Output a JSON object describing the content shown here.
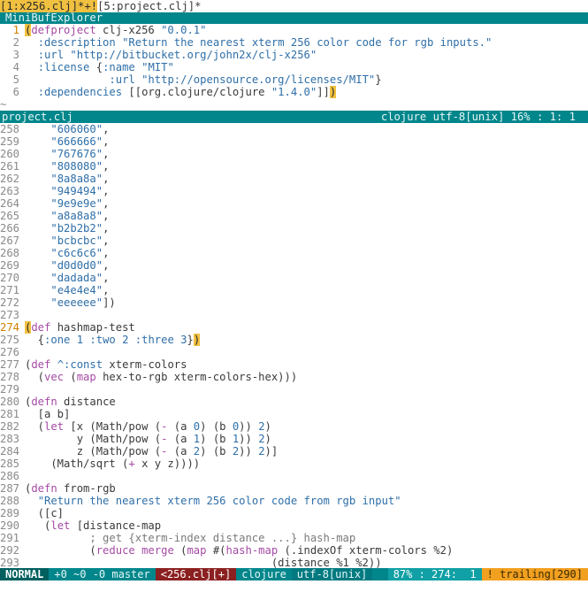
{
  "buffer_tabs": {
    "active": "[1:x256.clj]*+!",
    "other": "[5:project.clj]*"
  },
  "minibuf_title": "MiniBufExplorer",
  "top_window": {
    "lines": [
      {
        "n": "1",
        "cur": true,
        "tokens": [
          [
            "hl",
            "("
          ],
          [
            "fn",
            "defproject"
          ],
          [
            "p",
            " clj-x256 "
          ],
          [
            "str",
            "\"0.0.1\""
          ]
        ]
      },
      {
        "n": "2",
        "tokens": [
          [
            "p",
            "  "
          ],
          [
            "kwd",
            ":description"
          ],
          [
            "p",
            " "
          ],
          [
            "str",
            "\"Return the nearest xterm 256 color code for rgb inputs.\""
          ]
        ]
      },
      {
        "n": "3",
        "tokens": [
          [
            "p",
            "  "
          ],
          [
            "kwd",
            ":url"
          ],
          [
            "p",
            " "
          ],
          [
            "str",
            "\"http://bitbucket.org/john2x/clj-x256\""
          ]
        ]
      },
      {
        "n": "4",
        "tokens": [
          [
            "p",
            "  "
          ],
          [
            "kwd",
            ":license"
          ],
          [
            "p",
            " {"
          ],
          [
            "kwd",
            ":name"
          ],
          [
            "p",
            " "
          ],
          [
            "str",
            "\"MIT\""
          ]
        ]
      },
      {
        "n": "5",
        "tokens": [
          [
            "p",
            "             "
          ],
          [
            "kwd",
            ":url"
          ],
          [
            "p",
            " "
          ],
          [
            "str",
            "\"http://opensource.org/licenses/MIT\""
          ],
          [
            "p",
            "}"
          ]
        ]
      },
      {
        "n": "6",
        "tokens": [
          [
            "p",
            "  "
          ],
          [
            "kwd",
            ":dependencies"
          ],
          [
            "p",
            " [[org.clojure/clojure "
          ],
          [
            "str",
            "\"1.4.0\""
          ],
          [
            "p",
            "]]"
          ],
          [
            "hl",
            ")"
          ]
        ]
      }
    ],
    "tilde": "~"
  },
  "status_project": {
    "left": "project.clj",
    "right": "clojure  utf-8[unix]   16% :   1:  1"
  },
  "main_window": {
    "lines": [
      {
        "n": "258",
        "tokens": [
          [
            "p",
            "    "
          ],
          [
            "str",
            "\"606060\""
          ],
          [
            "p",
            ","
          ]
        ]
      },
      {
        "n": "259",
        "tokens": [
          [
            "p",
            "    "
          ],
          [
            "str",
            "\"666666\""
          ],
          [
            "p",
            ","
          ]
        ]
      },
      {
        "n": "260",
        "tokens": [
          [
            "p",
            "    "
          ],
          [
            "str",
            "\"767676\""
          ],
          [
            "p",
            ","
          ]
        ]
      },
      {
        "n": "261",
        "tokens": [
          [
            "p",
            "    "
          ],
          [
            "str",
            "\"808080\""
          ],
          [
            "p",
            ","
          ]
        ]
      },
      {
        "n": "262",
        "tokens": [
          [
            "p",
            "    "
          ],
          [
            "str",
            "\"8a8a8a\""
          ],
          [
            "p",
            ","
          ]
        ]
      },
      {
        "n": "263",
        "tokens": [
          [
            "p",
            "    "
          ],
          [
            "str",
            "\"949494\""
          ],
          [
            "p",
            ","
          ]
        ]
      },
      {
        "n": "264",
        "tokens": [
          [
            "p",
            "    "
          ],
          [
            "str",
            "\"9e9e9e\""
          ],
          [
            "p",
            ","
          ]
        ]
      },
      {
        "n": "265",
        "tokens": [
          [
            "p",
            "    "
          ],
          [
            "str",
            "\"a8a8a8\""
          ],
          [
            "p",
            ","
          ]
        ]
      },
      {
        "n": "266",
        "tokens": [
          [
            "p",
            "    "
          ],
          [
            "str",
            "\"b2b2b2\""
          ],
          [
            "p",
            ","
          ]
        ]
      },
      {
        "n": "267",
        "tokens": [
          [
            "p",
            "    "
          ],
          [
            "str",
            "\"bcbcbc\""
          ],
          [
            "p",
            ","
          ]
        ]
      },
      {
        "n": "268",
        "tokens": [
          [
            "p",
            "    "
          ],
          [
            "str",
            "\"c6c6c6\""
          ],
          [
            "p",
            ","
          ]
        ]
      },
      {
        "n": "269",
        "tokens": [
          [
            "p",
            "    "
          ],
          [
            "str",
            "\"d0d0d0\""
          ],
          [
            "p",
            ","
          ]
        ]
      },
      {
        "n": "270",
        "tokens": [
          [
            "p",
            "    "
          ],
          [
            "str",
            "\"dadada\""
          ],
          [
            "p",
            ","
          ]
        ]
      },
      {
        "n": "271",
        "tokens": [
          [
            "p",
            "    "
          ],
          [
            "str",
            "\"e4e4e4\""
          ],
          [
            "p",
            ","
          ]
        ]
      },
      {
        "n": "272",
        "tokens": [
          [
            "p",
            "    "
          ],
          [
            "str",
            "\"eeeeee\""
          ],
          [
            "p",
            "])"
          ]
        ]
      },
      {
        "n": "273",
        "tokens": []
      },
      {
        "n": "274",
        "cur": true,
        "tokens": [
          [
            "hl",
            "("
          ],
          [
            "kw",
            "def"
          ],
          [
            "p",
            " hashmap-test"
          ]
        ]
      },
      {
        "n": "275",
        "tokens": [
          [
            "p",
            "  {"
          ],
          [
            "kwd",
            ":one"
          ],
          [
            "p",
            " "
          ],
          [
            "num",
            "1"
          ],
          [
            "p",
            " "
          ],
          [
            "kwd",
            ":two"
          ],
          [
            "p",
            " "
          ],
          [
            "num",
            "2"
          ],
          [
            "p",
            " "
          ],
          [
            "kwd",
            ":three"
          ],
          [
            "p",
            " "
          ],
          [
            "num",
            "3"
          ],
          [
            "p",
            "}"
          ],
          [
            "hl",
            ")"
          ]
        ]
      },
      {
        "n": "276",
        "tokens": []
      },
      {
        "n": "277",
        "tokens": [
          [
            "p",
            "("
          ],
          [
            "kw",
            "def"
          ],
          [
            "p",
            " "
          ],
          [
            "kwd",
            "^:const"
          ],
          [
            "p",
            " xterm-colors"
          ]
        ]
      },
      {
        "n": "278",
        "tokens": [
          [
            "p",
            "  ("
          ],
          [
            "fn",
            "vec"
          ],
          [
            "p",
            " ("
          ],
          [
            "fn",
            "map"
          ],
          [
            "p",
            " hex-to-rgb xterm-colors-hex)))"
          ]
        ]
      },
      {
        "n": "279",
        "tokens": []
      },
      {
        "n": "280",
        "tokens": [
          [
            "p",
            "("
          ],
          [
            "kw",
            "defn"
          ],
          [
            "p",
            " distance"
          ]
        ]
      },
      {
        "n": "281",
        "tokens": [
          [
            "p",
            "  [a b]"
          ]
        ]
      },
      {
        "n": "282",
        "tokens": [
          [
            "p",
            "  ("
          ],
          [
            "kw",
            "let"
          ],
          [
            "p",
            " [x (Math/pow ("
          ],
          [
            "fn",
            "-"
          ],
          [
            "p",
            " (a "
          ],
          [
            "num",
            "0"
          ],
          [
            "p",
            ") (b "
          ],
          [
            "num",
            "0"
          ],
          [
            "p",
            ")) "
          ],
          [
            "num",
            "2"
          ],
          [
            "p",
            ")"
          ]
        ]
      },
      {
        "n": "283",
        "tokens": [
          [
            "p",
            "        y (Math/pow ("
          ],
          [
            "fn",
            "-"
          ],
          [
            "p",
            " (a "
          ],
          [
            "num",
            "1"
          ],
          [
            "p",
            ") (b "
          ],
          [
            "num",
            "1"
          ],
          [
            "p",
            ")) "
          ],
          [
            "num",
            "2"
          ],
          [
            "p",
            ")"
          ]
        ]
      },
      {
        "n": "284",
        "tokens": [
          [
            "p",
            "        z (Math/pow ("
          ],
          [
            "fn",
            "-"
          ],
          [
            "p",
            " (a "
          ],
          [
            "num",
            "2"
          ],
          [
            "p",
            ") (b "
          ],
          [
            "num",
            "2"
          ],
          [
            "p",
            ")) "
          ],
          [
            "num",
            "2"
          ],
          [
            "p",
            ")]"
          ]
        ]
      },
      {
        "n": "285",
        "tokens": [
          [
            "p",
            "    (Math/sqrt ("
          ],
          [
            "fn",
            "+"
          ],
          [
            "p",
            " x y z))))"
          ]
        ]
      },
      {
        "n": "286",
        "tokens": []
      },
      {
        "n": "287",
        "tokens": [
          [
            "p",
            "("
          ],
          [
            "kw",
            "defn"
          ],
          [
            "p",
            " from-rgb"
          ]
        ]
      },
      {
        "n": "288",
        "tokens": [
          [
            "p",
            "  "
          ],
          [
            "str",
            "\"Return the nearest xterm 256 color code from rgb input\""
          ]
        ]
      },
      {
        "n": "289",
        "tokens": [
          [
            "p",
            "  ([c]"
          ]
        ]
      },
      {
        "n": "290",
        "tokens": [
          [
            "p",
            "   ("
          ],
          [
            "kw",
            "let"
          ],
          [
            "p",
            " [distance-map"
          ]
        ]
      },
      {
        "n": "291",
        "tokens": [
          [
            "p",
            "          "
          ],
          [
            "cmt",
            "; get {xterm-index distance ...} hash-map"
          ]
        ]
      },
      {
        "n": "292",
        "tokens": [
          [
            "p",
            "          ("
          ],
          [
            "fn",
            "reduce"
          ],
          [
            "p",
            " "
          ],
          [
            "fn",
            "merge"
          ],
          [
            "p",
            " ("
          ],
          [
            "fn",
            "map"
          ],
          [
            "p",
            " #("
          ],
          [
            "fn",
            "hash-map"
          ],
          [
            "p",
            " (.indexOf xterm-colors %2)"
          ]
        ]
      },
      {
        "n": "293",
        "tokens": [
          [
            "p",
            "                                      (distance %1 %2))"
          ]
        ]
      }
    ]
  },
  "airline": {
    "mode": "NORMAL",
    "git": "+0 ~0 -0 master",
    "file": "<256.clj[+]",
    "filetype": "clojure",
    "encoding": "utf-8[unix]",
    "position": "87% : 274:  1",
    "warning": "! trailing[290]"
  }
}
